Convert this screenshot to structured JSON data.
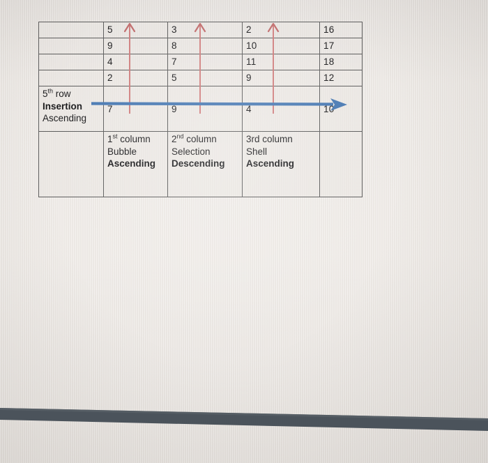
{
  "document": {
    "type": "scanned-worksheet-table",
    "background_color": "#ece8e4"
  },
  "table": {
    "number_rows": [
      {
        "label": "",
        "c1": "5",
        "c2": "3",
        "c3": "2",
        "c4": "16"
      },
      {
        "label": "",
        "c1": "9",
        "c2": "8",
        "c3": "10",
        "c4": "17"
      },
      {
        "label": "",
        "c1": "4",
        "c2": "7",
        "c3": "11",
        "c4": "18"
      },
      {
        "label": "",
        "c1": "2",
        "c2": "5",
        "c3": "9",
        "c4": "12"
      }
    ],
    "middle_row": {
      "label_line1_prefix": "5",
      "label_line1_sup": "th",
      "label_line1_suffix": " row",
      "label_line2": "Insertion",
      "label_line3": "Ascending",
      "c1": "7",
      "c2": "9",
      "c3": "4",
      "c4": "10"
    },
    "footer_row": {
      "label": "",
      "col1": {
        "header_prefix": "1",
        "header_sup": "st",
        "header_suffix": " column",
        "algorithm": "Bubble",
        "order": "Ascending"
      },
      "col2": {
        "header_prefix": "2",
        "header_sup": "nd",
        "header_suffix": " column",
        "algorithm": "Selection",
        "order": "Descending"
      },
      "col3": {
        "header_prefix": "3rd",
        "header_sup": "",
        "header_suffix": " column",
        "algorithm": "Shell",
        "order": "Ascending"
      },
      "col4": ""
    }
  },
  "annotations": {
    "blue_arrow": {
      "name": "row-direction-arrow",
      "color": "#4a7ab3",
      "direction": "right",
      "meaning": "5th row Insertion Ascending"
    },
    "red_arrows": {
      "name": "column-direction-arrows",
      "color": "#cf7a7a",
      "direction": "up",
      "count": 3,
      "meaning": "column sort direction markers"
    }
  },
  "bottom_bar": {
    "name": "dark-screen-edge-bar",
    "color": "#4b535b"
  }
}
